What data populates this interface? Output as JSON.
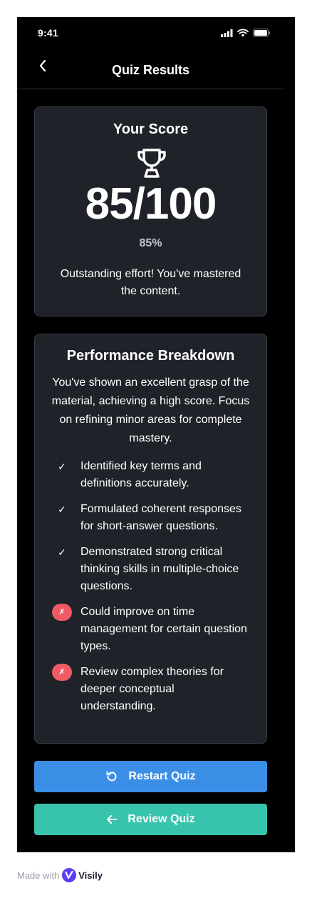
{
  "status_bar": {
    "time": "9:41"
  },
  "nav": {
    "title": "Quiz Results"
  },
  "score_card": {
    "title": "Your Score",
    "score": "85/100",
    "percent": "85%",
    "message": "Outstanding effort! You've mastered the content."
  },
  "breakdown": {
    "title": "Performance Breakdown",
    "summary": "You've shown an excellent grasp of the material, achieving a high score. Focus on refining minor areas for complete mastery.",
    "items": [
      {
        "status": "positive",
        "mark": "✓",
        "text": "Identified key terms and definitions accurately."
      },
      {
        "status": "positive",
        "mark": "✓",
        "text": "Formulated coherent responses for short-answer questions."
      },
      {
        "status": "positive",
        "mark": "✓",
        "text": "Demonstrated strong critical thinking skills in multiple-choice questions."
      },
      {
        "status": "negative",
        "mark": "✗",
        "text": "Could improve on time management for certain question types."
      },
      {
        "status": "negative",
        "mark": "✗",
        "text": "Review complex theories for deeper conceptual understanding."
      }
    ]
  },
  "actions": {
    "restart_label": "Restart Quiz",
    "review_label": "Review Quiz"
  },
  "footer": {
    "made_with": "Made with",
    "brand": "Visily"
  },
  "colors": {
    "restart_button": "#3a8ee6",
    "review_button": "#38c3ad",
    "negative_badge": "#ef5b64",
    "card_background": "#1f2228"
  },
  "icons": {
    "back": "chevron-left-icon",
    "trophy": "trophy-icon",
    "restart": "rotate-ccw-icon",
    "review": "arrow-left-icon",
    "positive": "check-icon",
    "negative": "x-icon"
  }
}
